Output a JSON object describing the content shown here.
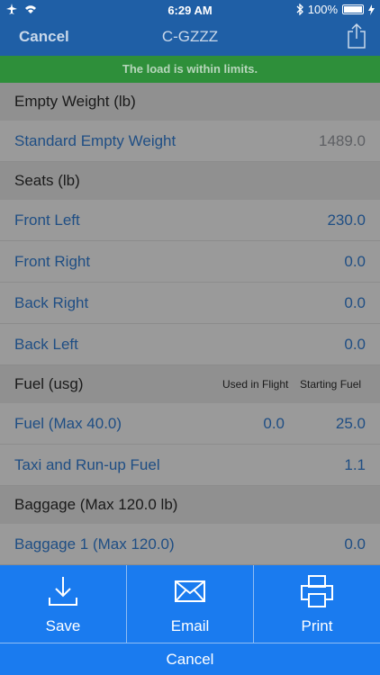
{
  "status_bar": {
    "time": "6:29 AM",
    "battery": "100%",
    "icons": [
      "airplane-mode-icon",
      "wifi-icon",
      "bluetooth-icon",
      "battery-icon",
      "charging-icon"
    ]
  },
  "nav": {
    "cancel_label": "Cancel",
    "title": "C-GZZZ",
    "share_icon": "share-icon"
  },
  "banner": {
    "message": "The load is within limits.",
    "color": "#2e8f3a"
  },
  "sections": {
    "empty_weight": {
      "header": "Empty Weight (lb)",
      "rows": [
        {
          "label": "Standard Empty Weight",
          "value": "1489.0"
        }
      ]
    },
    "seats": {
      "header": "Seats (lb)",
      "rows": [
        {
          "label": "Front Left",
          "value": "230.0"
        },
        {
          "label": "Front Right",
          "value": "0.0"
        },
        {
          "label": "Back Right",
          "value": "0.0"
        },
        {
          "label": "Back Left",
          "value": "0.0"
        }
      ]
    },
    "fuel": {
      "header": "Fuel (usg)",
      "col_used": "Used in Flight",
      "col_starting": "Starting Fuel",
      "rows": [
        {
          "label": "Fuel (Max 40.0)",
          "used": "0.0",
          "starting": "25.0"
        },
        {
          "label": "Taxi and Run-up Fuel",
          "value": "1.1"
        }
      ]
    },
    "baggage": {
      "header": "Baggage (Max 120.0 lb)",
      "rows": [
        {
          "label": "Baggage 1 (Max 120.0)",
          "value": "0.0"
        }
      ]
    }
  },
  "actions": {
    "save_label": "Save",
    "email_label": "Email",
    "print_label": "Print",
    "cancel_label": "Cancel"
  },
  "colors": {
    "nav_background": "#1f5fa6",
    "action_background": "#1a7bef",
    "value_text": "#1f4e84"
  }
}
